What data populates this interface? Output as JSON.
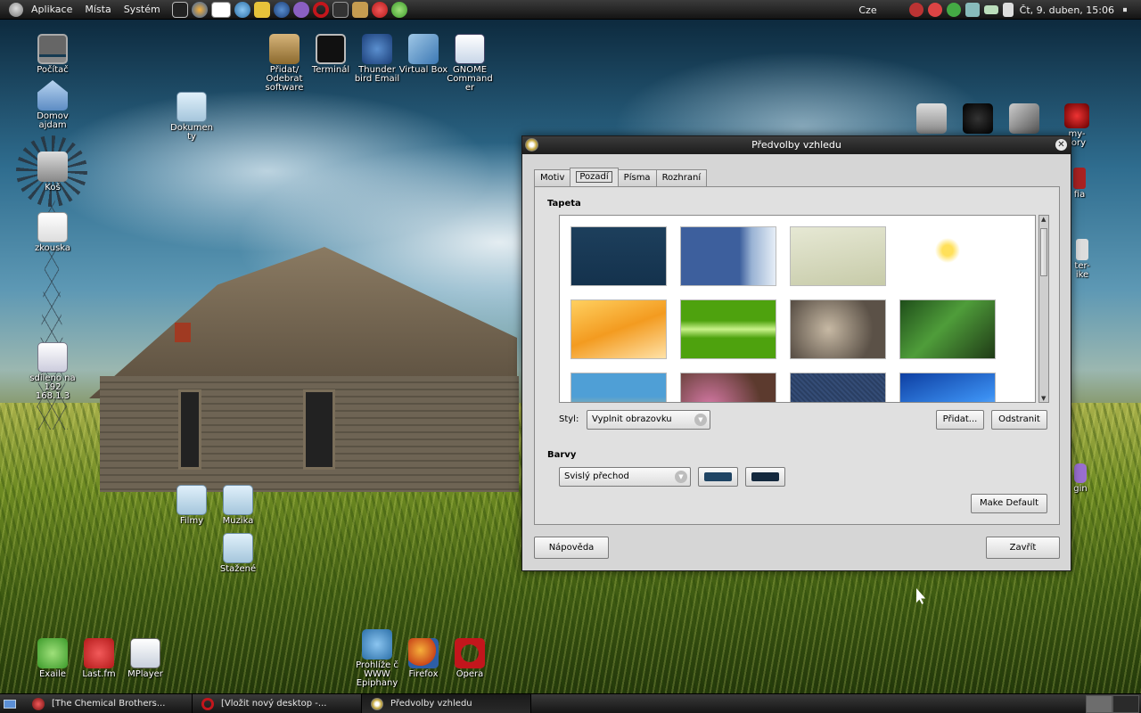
{
  "top_panel": {
    "menus": [
      "Aplikace",
      "Místa",
      "Systém"
    ],
    "tray_lang": "Cze",
    "clock": "Čt, 9. duben, 15:06"
  },
  "desktop_icons": {
    "computer": "Počítač",
    "home": "Domov ajdam",
    "trash": "Koš",
    "zkouska": "zkouska",
    "dokumenty": "Dokumen ty",
    "share": "sdíleno na 192 168.1.3",
    "filmy": "Filmy",
    "muzika": "Muzika",
    "stazene": "Stažené",
    "add_remove": "Přidat/ Odebrat software",
    "terminal": "Terminál",
    "thunderbird": "Thunder bird Email",
    "virtualbox": "Virtual Box",
    "gnome_commander": "GNOME Command er",
    "exaile": "Exaile",
    "lastfm": "Last.fm",
    "mplayer": "MPlayer",
    "epiphany": "Prohlíže č WWW Epiphany",
    "firefox": "Firefox",
    "opera": "Opera",
    "partial_1": "my- tory",
    "partial_2": "fia",
    "partial_3": "ter- ike",
    "partial_4": "gin"
  },
  "dialog": {
    "title": "Předvolby vzhledu",
    "tabs": [
      "Motiv",
      "Pozadí",
      "Písma",
      "Rozhraní"
    ],
    "active_tab": "Pozadí",
    "wallpaper_section": "Tapeta",
    "style_label": "Styl:",
    "style_value": "Vyplnit obrazovku",
    "add_button": "Přidat...",
    "remove_button": "Odstranit",
    "colors_section": "Barvy",
    "gradient_value": "Svislý přechod",
    "primary_color": "#1f4463",
    "secondary_color": "#14293e",
    "make_default": "Make Default",
    "help_button": "Nápověda",
    "close_button": "Zavřít"
  },
  "taskbar": {
    "tasks": [
      "[The Chemical Brothers...",
      "[Vložit nový desktop -...",
      "Předvolby vzhledu"
    ]
  }
}
